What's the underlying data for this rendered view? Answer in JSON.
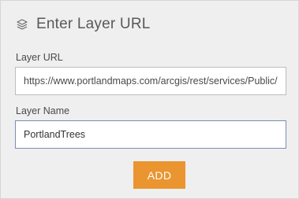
{
  "dialog": {
    "title": "Enter Layer URL",
    "title_icon": "layers-icon"
  },
  "layer_url": {
    "label": "Layer URL",
    "value": "https://www.portlandmaps.com/arcgis/rest/services/Public/"
  },
  "layer_name": {
    "label": "Layer Name",
    "value": "PortlandTrees"
  },
  "actions": {
    "add_label": "ADD"
  },
  "colors": {
    "panel_background": "#efefef",
    "add_button": "#ea9530",
    "focused_border": "#7a8fb0"
  }
}
